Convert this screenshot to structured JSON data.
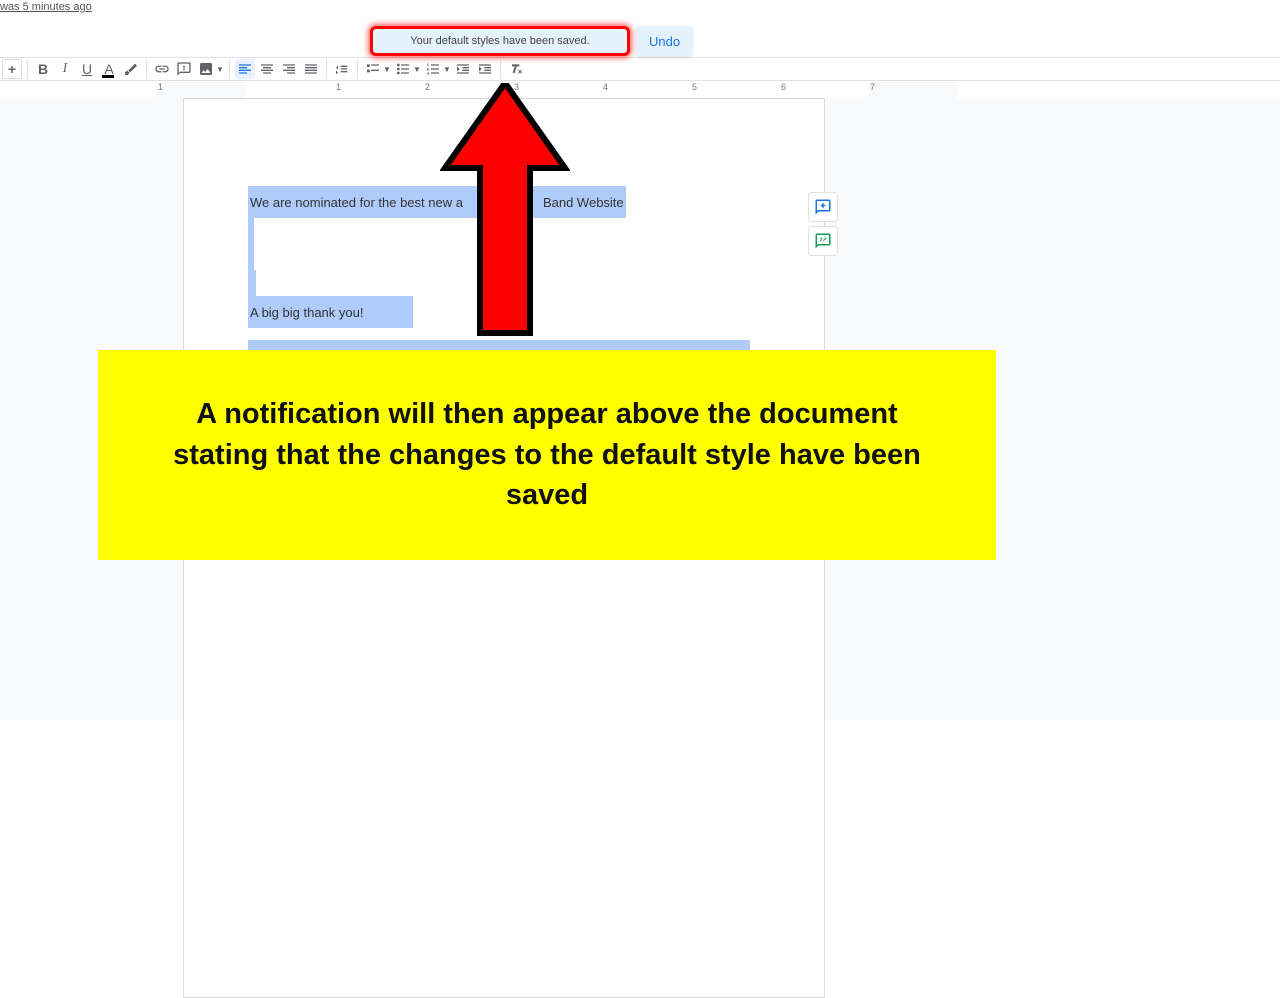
{
  "status_text": "was 5 minutes ago",
  "notification": {
    "message": "Your default styles have been saved.",
    "undo_label": "Undo"
  },
  "ruler_marks": [
    "1",
    "",
    "1",
    "2",
    "3",
    "4",
    "5",
    "6",
    "7"
  ],
  "document": {
    "line1_before": "We are nominated for the best new a",
    "line1_after": "Band Website",
    "line2": "A big big thank you!"
  },
  "caption": "A notification will then appear above the document stating that the changes to the default style have been saved",
  "colors": {
    "accent": "#1a73e8",
    "highlight": "#aecbfa",
    "caption_bg": "#ffff00",
    "arrow": "#ff0000"
  }
}
